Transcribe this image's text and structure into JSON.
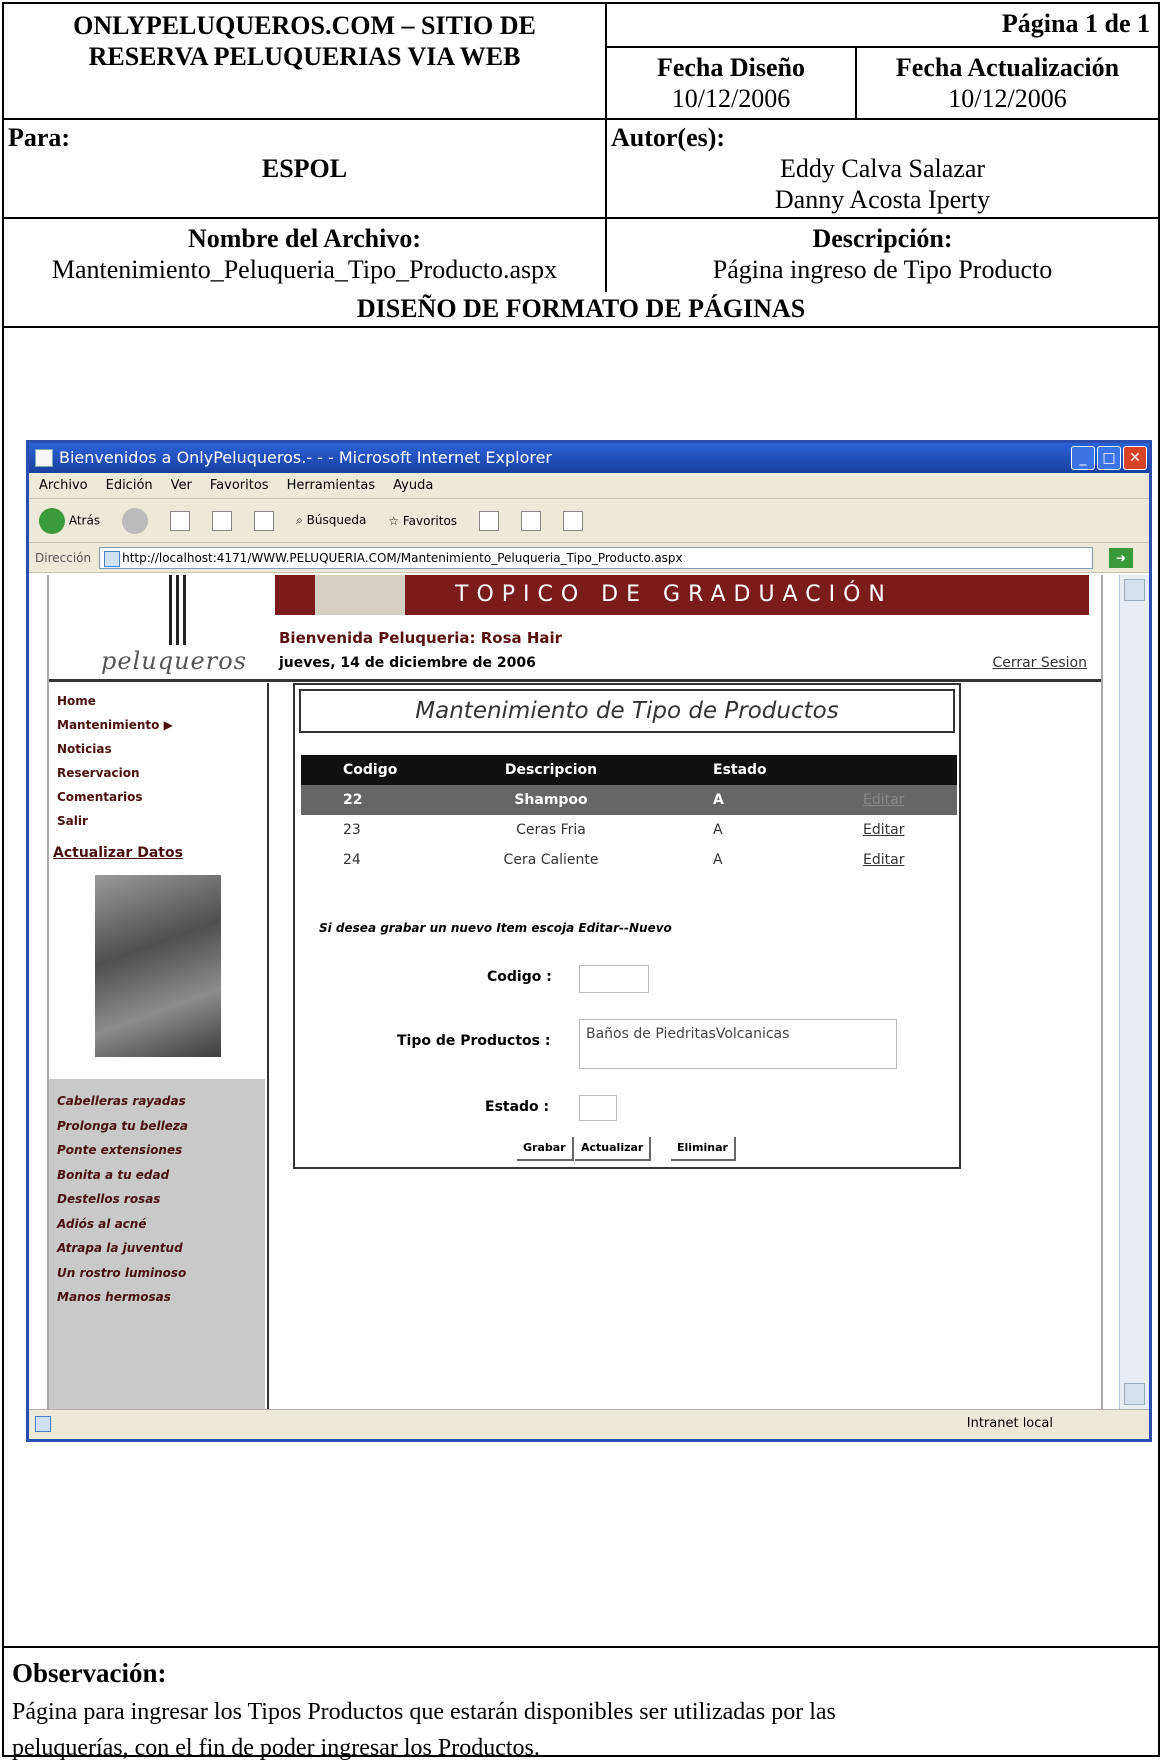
{
  "doc": {
    "site_title_1": "ONLYPELUQUEROS.COM – SITIO DE",
    "site_title_2": "RESERVA PELUQUERIAS VIA WEB",
    "page": "Página 1 de 1",
    "fecha_diseno_label": "Fecha Diseño",
    "fecha_diseno": "10/12/2006",
    "fecha_act_label": "Fecha Actualización",
    "fecha_act": "10/12/2006",
    "para_label": "Para:",
    "para": "ESPOL",
    "autor_label": "Autor(es):",
    "autor_1": "Eddy Calva Salazar",
    "autor_2": "Danny Acosta Iperty",
    "archivo_label": "Nombre del Archivo:",
    "archivo": "Mantenimiento_Peluqueria_Tipo_Producto.aspx",
    "desc_label": "Descripción:",
    "desc": "Página  ingreso de Tipo Producto",
    "section_title": "DISEÑO DE FORMATO DE PÁGINAS",
    "obs_label": "Observación:",
    "obs_1": "Página para ingresar los Tipos  Productos que estarán disponibles ser utilizadas por las",
    "obs_2": "peluquerías, con el fin de poder  ingresar los Productos."
  },
  "browser": {
    "title": "Bienvenidos a OnlyPeluqueros.- - - Microsoft Internet Explorer",
    "menu": [
      "Archivo",
      "Edición",
      "Ver",
      "Favoritos",
      "Herramientas",
      "Ayuda"
    ],
    "back": "Atrás",
    "search": "Búsqueda",
    "favorites": "Favoritos",
    "address_label": "Dirección",
    "url": "http://localhost:4171/WWW.PELUQUERIA.COM/Mantenimiento_Peluqueria_Tipo_Producto.aspx",
    "zone": "Intranet local"
  },
  "site": {
    "logo": "peluqueros",
    "banner": "TOPICO DE GRADUACIÓN",
    "welcome": "Bienvenida Peluqueria: Rosa Hair",
    "date": "jueves, 14 de diciembre de 2006",
    "logout": "Cerrar Sesion",
    "nav": [
      "Home",
      "Mantenimiento",
      "Noticias",
      "Reservacion",
      "Comentarios",
      "Salir"
    ],
    "update": "Actualizar Datos",
    "promo": [
      "Cabelleras rayadas",
      "Prolonga tu belleza",
      "Ponte extensiones",
      "Bonita a tu edad",
      "Destellos rosas",
      "Adiós al acné",
      "Atrapa la juventud",
      "Un rostro luminoso",
      "Manos hermosas"
    ]
  },
  "form": {
    "title": "Mantenimiento de Tipo de Productos",
    "columns": [
      "Codigo",
      "Descripcion",
      "Estado",
      ""
    ],
    "rows": [
      {
        "codigo": "22",
        "descripcion": "Shampoo",
        "estado": "A",
        "accion": "Editar"
      },
      {
        "codigo": "23",
        "descripcion": "Ceras Fria",
        "estado": "A",
        "accion": "Editar"
      },
      {
        "codigo": "24",
        "descripcion": "Cera Caliente",
        "estado": "A",
        "accion": "Editar"
      }
    ],
    "hint": "Si desea grabar un nuevo Item escoja Editar--Nuevo",
    "codigo_label": "Codigo",
    "tipo_label": "Tipo de Productos",
    "tipo_value": "Baños de PiedritasVolcanicas",
    "estado_label": "Estado",
    "btn_grabar": "Grabar",
    "btn_actualizar": "Actualizar",
    "btn_eliminar": "Eliminar"
  }
}
